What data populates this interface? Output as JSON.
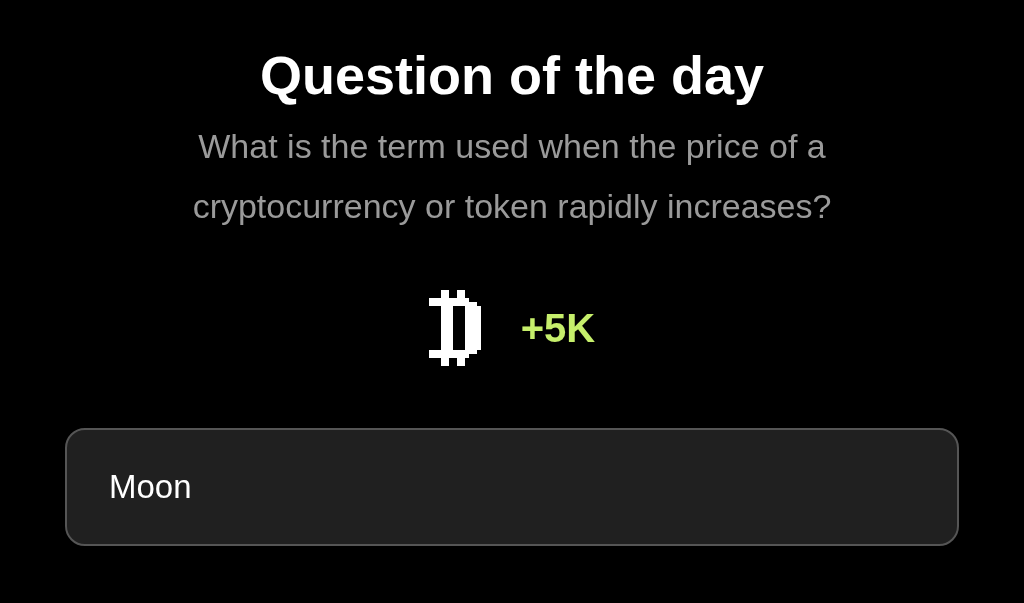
{
  "title": "Question of the day",
  "question": "What is the term used when the price of a cryptocurrency or token rapidly increases?",
  "reward": {
    "amount": "+5K"
  },
  "answer": {
    "value": "Moon"
  }
}
